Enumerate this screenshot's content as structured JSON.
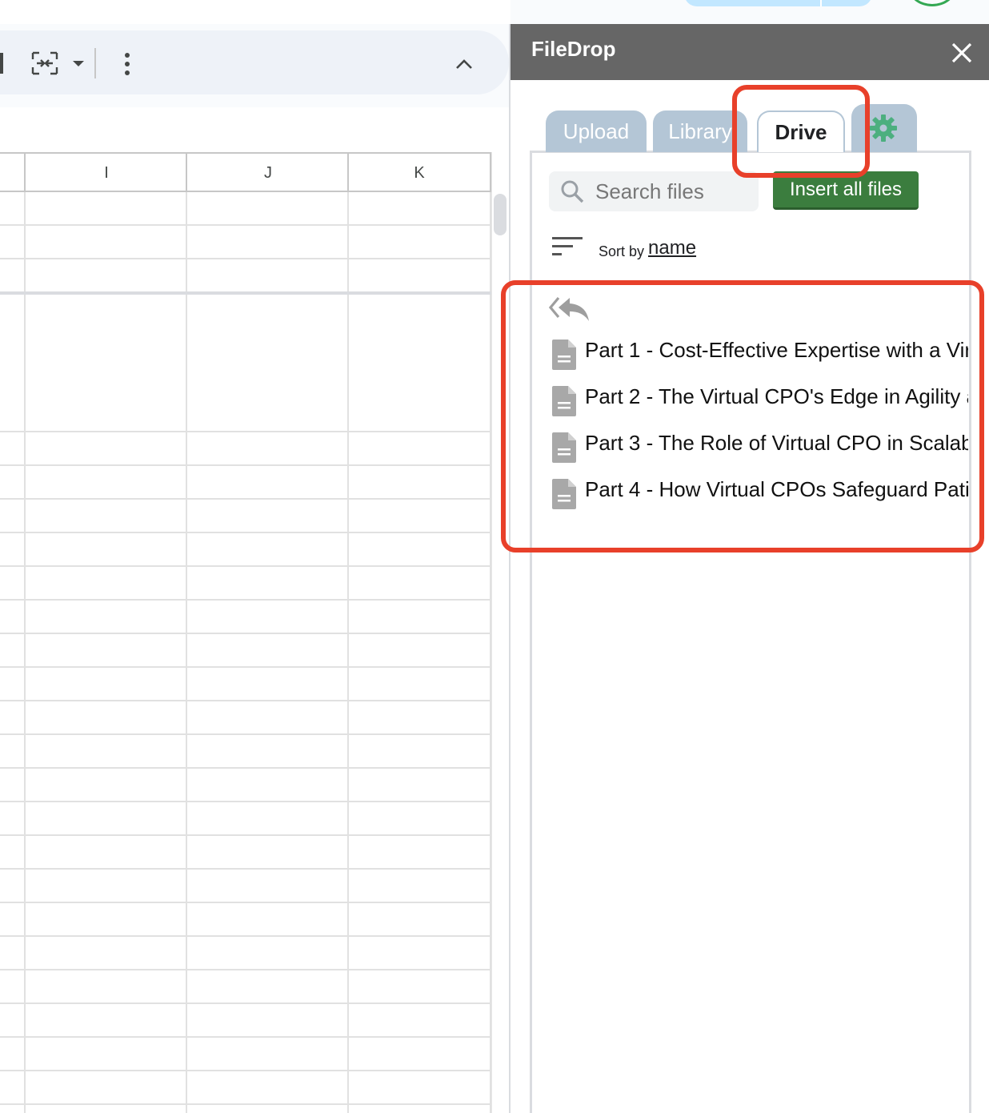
{
  "sheet": {
    "columns": [
      "I",
      "J",
      "K"
    ]
  },
  "toolbar": {
    "icons": [
      "merge-cells-icon",
      "caret-down-icon",
      "more-vert-icon",
      "chevron-up-icon"
    ]
  },
  "filedrop": {
    "title": "FileDrop",
    "tabs": {
      "upload": "Upload",
      "library": "Library",
      "drive": "Drive"
    },
    "active_tab": "Drive",
    "search": {
      "placeholder": "Search files",
      "value": ""
    },
    "insert_all_label": "Insert all files",
    "sort": {
      "label": "Sort by",
      "value": "name"
    },
    "files": [
      {
        "name": "Part 1 - Cost-Effective Expertise with a Vir"
      },
      {
        "name": "Part 2 - The Virtual CPO's Edge in Agility a"
      },
      {
        "name": "Part 3 - The Role of Virtual CPO in Scalab"
      },
      {
        "name": "Part 4 - How Virtual CPOs Safeguard Pati"
      }
    ]
  },
  "colors": {
    "header_bg": "#666666",
    "tab_inactive": "#b4c6d6",
    "insert_button": "#3b7d3e",
    "gear": "#4caf7f",
    "annotation": "#e8402a"
  }
}
